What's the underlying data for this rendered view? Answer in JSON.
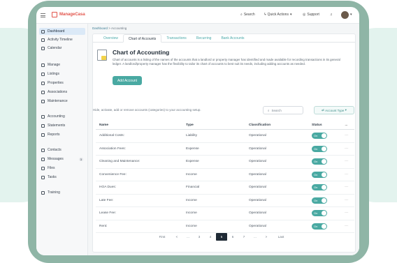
{
  "app": {
    "name": "ManageCasa"
  },
  "topbar": {
    "search_label": "Search",
    "quick_actions_label": "Quick Actions",
    "support_label": "Support"
  },
  "sidebar": {
    "items": [
      {
        "label": "Dashboard",
        "icon": "grid-icon",
        "active": true
      },
      {
        "label": "Activity Timeline",
        "icon": "activity-icon"
      },
      {
        "label": "Calendar",
        "icon": "calendar-icon"
      },
      {
        "label": "Manage",
        "icon": "briefcase-icon"
      },
      {
        "label": "Listings",
        "icon": "list-icon"
      },
      {
        "label": "Properties",
        "icon": "building-icon"
      },
      {
        "label": "Associations",
        "icon": "people-icon"
      },
      {
        "label": "Maintenance",
        "icon": "wrench-icon"
      },
      {
        "label": "Accounting",
        "icon": "coins-icon"
      },
      {
        "label": "Statements",
        "icon": "statement-icon"
      },
      {
        "label": "Reports",
        "icon": "bar-chart-icon"
      },
      {
        "label": "Contacts",
        "icon": "person-icon"
      },
      {
        "label": "Messages",
        "icon": "message-icon",
        "count": "3"
      },
      {
        "label": "Files",
        "icon": "folder-icon"
      },
      {
        "label": "Tasks",
        "icon": "tasks-icon"
      },
      {
        "label": "Training",
        "icon": "training-icon"
      }
    ]
  },
  "breadcrumb": {
    "root": "Dashboard",
    "sep": ">",
    "current": "Accounting"
  },
  "tabs": [
    {
      "label": "Overview"
    },
    {
      "label": "Chart of Accounts",
      "active": true
    },
    {
      "label": "Transactions"
    },
    {
      "label": "Recurring"
    },
    {
      "label": "Bank Accounts"
    }
  ],
  "header": {
    "title": "Chart of Accounting",
    "description": "Chart of accounts is a listing of the names of the accounts that a landlord or property manager has identified and made available for recording transactions in its general ledger. A landlord/property manager has the flexibility to tailor its chart of accounts to best suit its needs, including adding accounts as needed.",
    "add_button": "Add Account"
  },
  "toolbar": {
    "hint": "Hide, activate, add or remove accounts (categories) to your accounting setup.",
    "search_placeholder": "Search",
    "filter_label": "Account Type"
  },
  "table": {
    "columns": [
      "Name",
      "Type",
      "Classification",
      "Status",
      "..."
    ],
    "rows": [
      {
        "name": "Additional Costs:",
        "type": "Liability",
        "classification": "Operational",
        "status": "On"
      },
      {
        "name": "Association Fees:",
        "type": "Expense",
        "classification": "Operational",
        "status": "On"
      },
      {
        "name": "Cleaning and Maintenance:",
        "type": "Expense",
        "classification": "Operational",
        "status": "On"
      },
      {
        "name": "Convenience Fee:",
        "type": "Income",
        "classification": "Operational",
        "status": "On"
      },
      {
        "name": "HOA Dues:",
        "type": "Financial",
        "classification": "Operational",
        "status": "On"
      },
      {
        "name": "Late Fee:",
        "type": "Income",
        "classification": "Operational",
        "status": "On"
      },
      {
        "name": "Lease Fee:",
        "type": "Income",
        "classification": "Operational",
        "status": "On"
      },
      {
        "name": "Rent:",
        "type": "Income",
        "classification": "Operational",
        "status": "On"
      }
    ]
  },
  "pagination": {
    "first": "First",
    "pages": [
      "<",
      "...",
      "3",
      "4",
      "5",
      "6",
      "7",
      "...",
      ">"
    ],
    "last": "Last",
    "current": "5"
  },
  "colors": {
    "accent": "#49a9a2",
    "brand": "#e2534a",
    "frame": "#8fb5a6"
  }
}
